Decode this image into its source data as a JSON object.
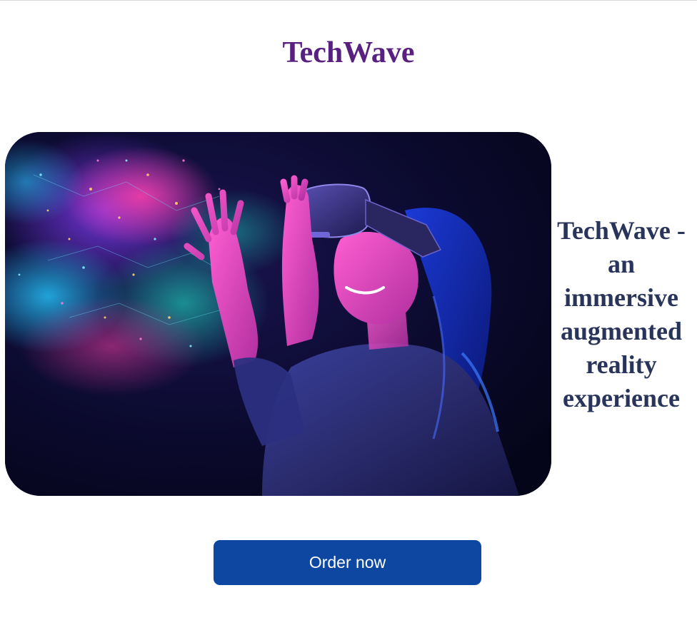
{
  "header": {
    "title": "TechWave"
  },
  "hero": {
    "image_alt": "Woman wearing a VR headset reaching toward glowing particles",
    "tagline": "TechWave - an immersive augmented reality experience"
  },
  "cta": {
    "order_label": "Order now"
  },
  "colors": {
    "title": "#58207f",
    "tagline": "#28345a",
    "button": "#0d47a1",
    "button_text": "#ffffff"
  }
}
